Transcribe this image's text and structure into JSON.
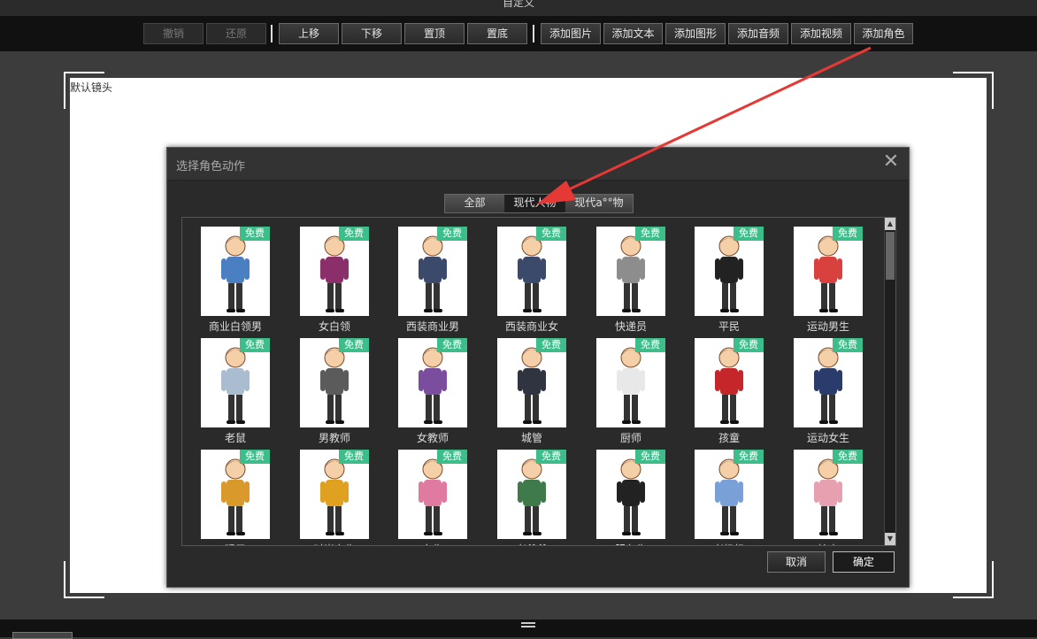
{
  "window": {
    "title": "自定义"
  },
  "toolbar": {
    "undo": "撤销",
    "redo": "还原",
    "move_up": "上移",
    "move_down": "下移",
    "to_top": "置顶",
    "to_bottom": "置底",
    "add_image": "添加图片",
    "add_text": "添加文本",
    "add_shape": "添加图形",
    "add_audio": "添加音频",
    "add_video": "添加视频",
    "add_character": "添加角色"
  },
  "stage": {
    "label": "默认镜头"
  },
  "dialog": {
    "title": "选择角色动作",
    "categories": [
      "全部",
      "现代人物",
      "现代a°°物"
    ],
    "active_category": 1,
    "badge": "免费",
    "cancel": "取消",
    "ok": "确定",
    "characters": [
      {
        "name": "商业白领男",
        "color": "#4a7fc1"
      },
      {
        "name": "女白领",
        "color": "#8b2f6b"
      },
      {
        "name": "西装商业男",
        "color": "#3b4a6b"
      },
      {
        "name": "西装商业女",
        "color": "#3b4a6b"
      },
      {
        "name": "快递员",
        "color": "#8d8d8d"
      },
      {
        "name": "平民",
        "color": "#222222"
      },
      {
        "name": "运动男生",
        "color": "#d9413e"
      },
      {
        "name": "老鼠",
        "color": "#a9bcd0"
      },
      {
        "name": "男教师",
        "color": "#5b5b5b"
      },
      {
        "name": "女教师",
        "color": "#7b4d9e"
      },
      {
        "name": "城管",
        "color": "#2f3440"
      },
      {
        "name": "厨师",
        "color": "#e8e8e8"
      },
      {
        "name": "孩童",
        "color": "#c4262a"
      },
      {
        "name": "运动女生",
        "color": "#2a3c6b"
      },
      {
        "name": "猴子",
        "color": "#d99a2b"
      },
      {
        "name": "时尚女生",
        "color": "#e0a020"
      },
      {
        "name": "女生",
        "color": "#e07aa0"
      },
      {
        "name": "老爷爷",
        "color": "#3f7a4b"
      },
      {
        "name": "服务生",
        "color": "#222222"
      },
      {
        "name": "老奶奶",
        "color": "#7aa0d8"
      },
      {
        "name": "护士",
        "color": "#e6a0b0"
      }
    ]
  },
  "colors": {
    "accent_badge": "#3dbd8a",
    "arrow": "#e53935"
  }
}
